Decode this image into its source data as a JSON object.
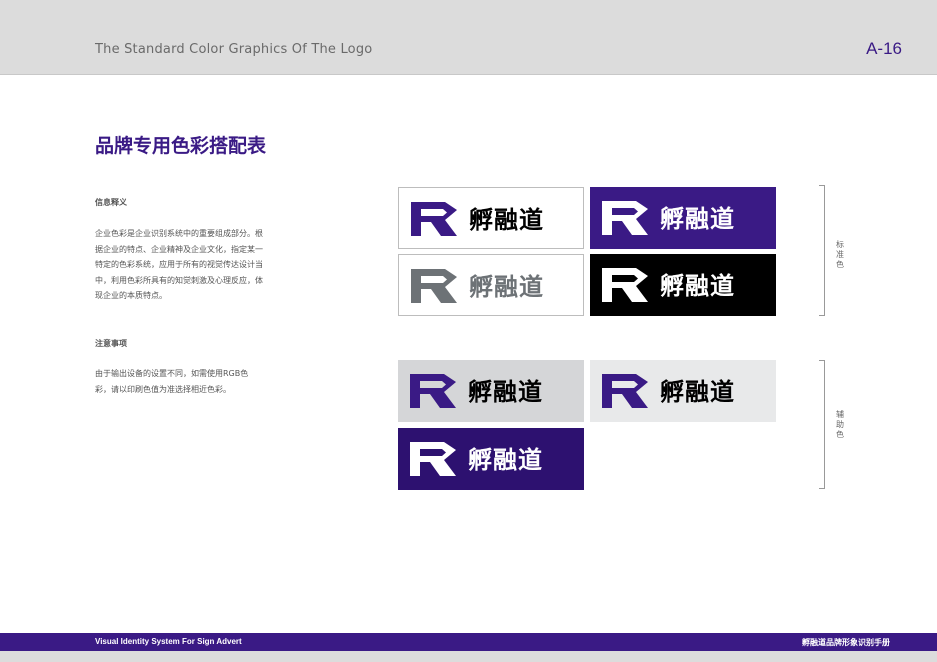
{
  "header": {
    "title": "The Standard Color Graphics Of The Logo",
    "page_number": "A-16"
  },
  "section_title": "品牌专用色彩搭配表",
  "info": {
    "heading": "信息释义",
    "lines": [
      "企业色彩是企业识别系统中的重要组成部分。根",
      "据企业的特点、企业精神及企业文化，指定某一",
      "特定的色彩系统，应用于所有的视觉传达设计当",
      "中，利用色彩所具有的知觉刺激及心理反应，体",
      "现企业的本质特点。"
    ]
  },
  "notes": {
    "heading": "注意事项",
    "lines": [
      "由于输出设备的设置不同，如需使用RGB色",
      "彩，请以印刷色值为准选择相近色彩。"
    ]
  },
  "logo_text": "孵融道",
  "colors": {
    "brand_purple": "#3a1a85",
    "dark_purple": "#2d1170",
    "gray": "#6d7276",
    "black": "#000000",
    "light_gray": "#e8e9ea",
    "mid_gray": "#d5d6d8"
  },
  "labels": {
    "standard": "标准色",
    "auxiliary": "辅助色"
  },
  "footer": {
    "left": "Visual Identity System For Sign Advert",
    "right": "孵融道品牌形象识别手册"
  }
}
